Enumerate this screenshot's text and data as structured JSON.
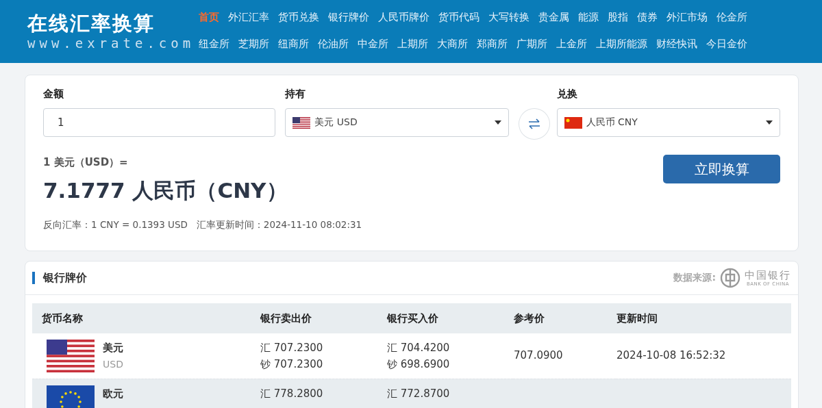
{
  "header": {
    "logo": "在线汇率换算",
    "site": "www.exrate.com",
    "nav_rows": [
      [
        {
          "label": "首页",
          "selected": true
        },
        {
          "label": "外汇汇率",
          "selected": false
        },
        {
          "label": "货币兑换",
          "selected": false
        },
        {
          "label": "银行牌价",
          "selected": false
        },
        {
          "label": "人民币牌价",
          "selected": false
        },
        {
          "label": "货币代码",
          "selected": false
        },
        {
          "label": "大写转换",
          "selected": false
        },
        {
          "label": "贵金属",
          "selected": false
        },
        {
          "label": "能源",
          "selected": false
        },
        {
          "label": "股指",
          "selected": false
        },
        {
          "label": "债券",
          "selected": false
        },
        {
          "label": "外汇市场",
          "selected": false
        },
        {
          "label": "伦金所",
          "selected": false
        }
      ],
      [
        {
          "label": "纽金所",
          "selected": false
        },
        {
          "label": "芝期所",
          "selected": false
        },
        {
          "label": "纽商所",
          "selected": false
        },
        {
          "label": "伦油所",
          "selected": false
        },
        {
          "label": "中金所",
          "selected": false
        },
        {
          "label": "上期所",
          "selected": false
        },
        {
          "label": "大商所",
          "selected": false
        },
        {
          "label": "郑商所",
          "selected": false
        },
        {
          "label": "广期所",
          "selected": false
        },
        {
          "label": "上金所",
          "selected": false
        },
        {
          "label": "上期所能源",
          "selected": false
        },
        {
          "label": "财经快讯",
          "selected": false
        },
        {
          "label": "今日金价",
          "selected": false
        }
      ]
    ]
  },
  "converter": {
    "amount_label": "金额",
    "amount": "1",
    "from_label": "持有",
    "from": {
      "kind": "us",
      "text": "美元 USD"
    },
    "to_label": "兑换",
    "to": {
      "kind": "cn",
      "text": "人民币 CNY"
    },
    "result_line": "1 美元（USD）=",
    "result": "7.1777 人民币（CNY）",
    "convert_button": "立即换算",
    "footnote": "反向汇率：1 CNY = 0.1393 USD   汇率更新时间：2024-11-10 08:02:31"
  },
  "bank_rates": {
    "title": "银行牌价",
    "source_label": "数据来源:",
    "source_name": "中国银行",
    "source_name_en": "BANK OF CHINA",
    "columns": [
      "货币名称",
      "银行卖出价",
      "银行买入价",
      "参考价",
      "更新时间"
    ],
    "rows": [
      {
        "kind": "us",
        "name": "美元",
        "code": "USD",
        "sell": [
          "汇 707.2300",
          "钞 707.2300"
        ],
        "buy": [
          "汇 704.4200",
          "钞 698.6900"
        ],
        "reference": "707.0900",
        "updated": "2024-10-08 16:52:32"
      },
      {
        "kind": "eu",
        "name": "欧元",
        "sell": [
          "汇 778.2800"
        ],
        "buy": [
          "汇 772.8700"
        ]
      }
    ]
  }
}
